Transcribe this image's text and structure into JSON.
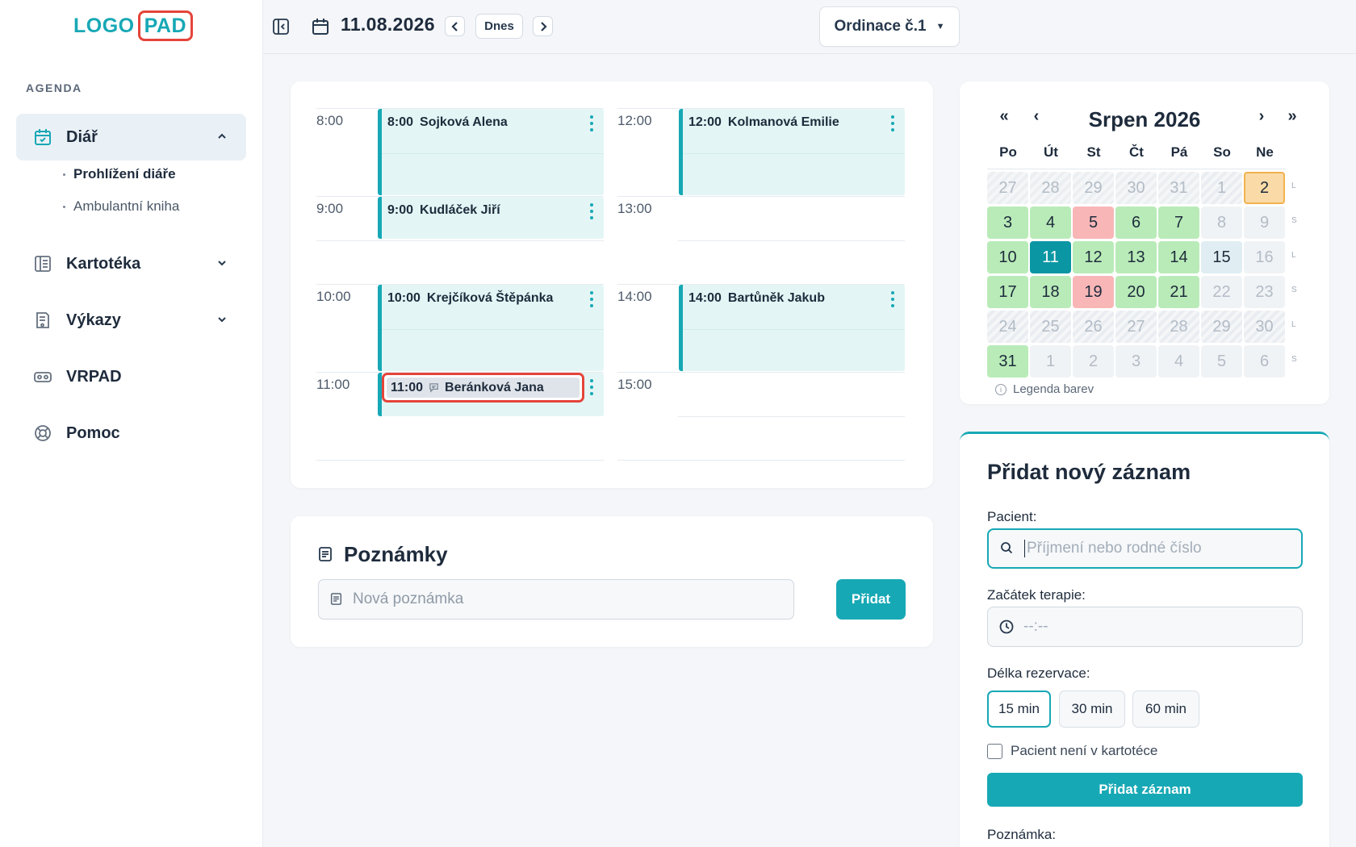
{
  "brand": {
    "logo_part1": "LOGO",
    "logo_part2": "PAD"
  },
  "header": {
    "date": "11.08.2026",
    "today_label": "Dnes",
    "office": "Ordinace č.1"
  },
  "sidebar": {
    "section": "AGENDA",
    "items": [
      {
        "label": "Diář",
        "icon": "calendar-check-icon"
      },
      {
        "label": "Kartotéka",
        "icon": "card-file-icon"
      },
      {
        "label": "Výkazy",
        "icon": "report-icon"
      },
      {
        "label": "VRPAD",
        "icon": "vr-headset-icon"
      },
      {
        "label": "Pomoc",
        "icon": "lifebuoy-icon"
      }
    ],
    "sub_items": [
      "Prohlížení diáře",
      "Ambulantní kniha"
    ]
  },
  "schedule": {
    "times_left": [
      "8:00",
      "9:00",
      "10:00",
      "11:00"
    ],
    "times_right": [
      "12:00",
      "13:00",
      "14:00",
      "15:00"
    ],
    "appointments": [
      {
        "time": "8:00",
        "name": "Sojková Alena"
      },
      {
        "time": "9:00",
        "name": "Kudláček Jiří"
      },
      {
        "time": "10:00",
        "name": "Krejčíková Štěpánka"
      },
      {
        "time": "11:00",
        "name": "Beránková Jana"
      },
      {
        "time": "12:00",
        "name": "Kolmanová Emilie"
      },
      {
        "time": "14:00",
        "name": "Bartůněk Jakub"
      }
    ]
  },
  "notes": {
    "title": "Poznámky",
    "placeholder": "Nová poznámka",
    "add_label": "Přidat"
  },
  "calendar": {
    "first": "«",
    "prev": "‹",
    "next": "›",
    "last": "»",
    "title": "Srpen 2026",
    "dow": [
      "Po",
      "Út",
      "St",
      "Čt",
      "Pá",
      "So",
      "Ne"
    ],
    "weeks": [
      {
        "days": [
          "27",
          "28",
          "29",
          "30",
          "31",
          "1",
          "2"
        ],
        "tag": "L"
      },
      {
        "days": [
          "3",
          "4",
          "5",
          "6",
          "7",
          "8",
          "9"
        ],
        "tag": "S"
      },
      {
        "days": [
          "10",
          "11",
          "12",
          "13",
          "14",
          "15",
          "16"
        ],
        "tag": "L"
      },
      {
        "days": [
          "17",
          "18",
          "19",
          "20",
          "21",
          "22",
          "23"
        ],
        "tag": "S"
      },
      {
        "days": [
          "24",
          "25",
          "26",
          "27",
          "28",
          "29",
          "30"
        ],
        "tag": "L"
      },
      {
        "days": [
          "31",
          "1",
          "2",
          "3",
          "4",
          "5",
          "6"
        ],
        "tag": "S"
      }
    ],
    "legend": "Legenda barev",
    "colors": {
      "available": "#b9ebb8",
      "full": "#f8b6b7",
      "selected": "#0a96a3",
      "sunday": "#fadba7"
    }
  },
  "form": {
    "title": "Přidat nový záznam",
    "patient_label": "Pacient:",
    "patient_placeholder": "Příjmení nebo rodné číslo",
    "start_label": "Začátek terapie:",
    "start_placeholder": "--:--",
    "duration_label": "Délka rezervace:",
    "durations": [
      "15 min",
      "30 min",
      "60 min"
    ],
    "not_in_file": "Pacient není v kartotéce",
    "submit": "Přidat záznam",
    "note_label": "Poznámka:"
  },
  "accent_color": "#17a8b5"
}
